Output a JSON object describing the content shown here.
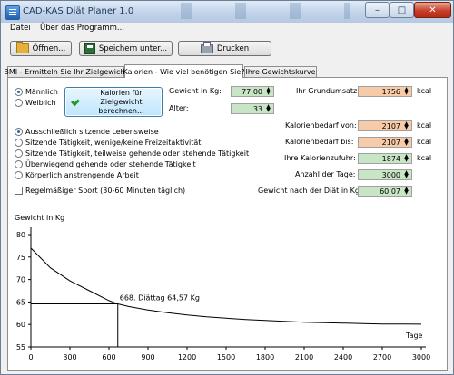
{
  "window": {
    "title": "CAD-KAS Diät Planer 1.0",
    "controls": {
      "minimize": "–",
      "maximize": "□",
      "close": "✕"
    }
  },
  "menu": [
    "Datei",
    "Über das Programm..."
  ],
  "toolbar": {
    "open": "Öffnen...",
    "save_as": "Speichern unter...",
    "print": "Drucken"
  },
  "tabs": [
    "BMI - Ermitteln Sie Ihr Zielgewicht",
    "Kalorien - Wie viel benötigen Sie?",
    "Ihre Gewichtskurve"
  ],
  "active_tab": 1,
  "form": {
    "gender": {
      "male": "Männlich",
      "female": "Weiblich",
      "selected": "male"
    },
    "calc_button": [
      "Kalorien für Zielgewicht",
      "berechnen..."
    ],
    "weight_label": "Gewicht in Kg:",
    "weight_value": "77,00",
    "age_label": "Alter:",
    "age_value": "33",
    "bmr_label": "Ihr Grundumsatz:",
    "bmr_value": "1756",
    "bmr_unit": "kcal",
    "activity": [
      "Ausschließlich sitzende Lebensweise",
      "Sitzende Tätigkeit, wenige/keine Freizeitaktivität",
      "Sitzende Tätigkeit, teilweise gehende oder stehende Tätigkeit",
      "Überwiegend gehende oder stehende Tätigkeit",
      "Körperlich anstrengende Arbeit"
    ],
    "activity_selected": 0,
    "sport_label": "Regelmäßiger Sport (30-60 Minuten täglich)",
    "sport_checked": false,
    "need_from_label": "Kalorienbedarf von:",
    "need_from_value": "2107",
    "need_to_label": "Kalorienbedarf bis:",
    "need_to_value": "2107",
    "intake_label": "Ihre Kalorienzufuhr:",
    "intake_value": "1874",
    "days_label": "Anzahl der Tage:",
    "days_value": "3000",
    "end_weight_label": "Gewicht nach der Diät in Kg:",
    "end_weight_value": "60,07",
    "unit_kcal": "kcal"
  },
  "chart_data": {
    "type": "line",
    "ylabel": "Gewicht in Kg",
    "xlabel": "Tage",
    "xlim": [
      0,
      3000
    ],
    "ylim": [
      55,
      80
    ],
    "xticks": [
      0,
      300,
      600,
      900,
      1200,
      1500,
      1800,
      2100,
      2400,
      2700,
      3000
    ],
    "yticks": [
      55,
      60,
      65,
      70,
      75,
      80
    ],
    "series": [
      {
        "x": [
          0,
          150,
          300,
          450,
          600,
          668,
          750,
          900,
          1050,
          1200,
          1350,
          1500,
          1650,
          1800,
          1950,
          2100,
          2250,
          2400,
          2550,
          2700,
          2850,
          3000
        ],
        "values": [
          77.0,
          72.6,
          69.7,
          67.5,
          65.3,
          64.57,
          64.0,
          63.2,
          62.6,
          62.1,
          61.7,
          61.4,
          61.1,
          60.9,
          60.7,
          60.5,
          60.4,
          60.3,
          60.2,
          60.1,
          60.08,
          60.07
        ]
      }
    ],
    "annotation": {
      "x": 668,
      "y": 64.57,
      "text": "668. Diättag 64,57 Kg"
    },
    "grid": false,
    "colors": {
      "line": "#000000"
    }
  }
}
